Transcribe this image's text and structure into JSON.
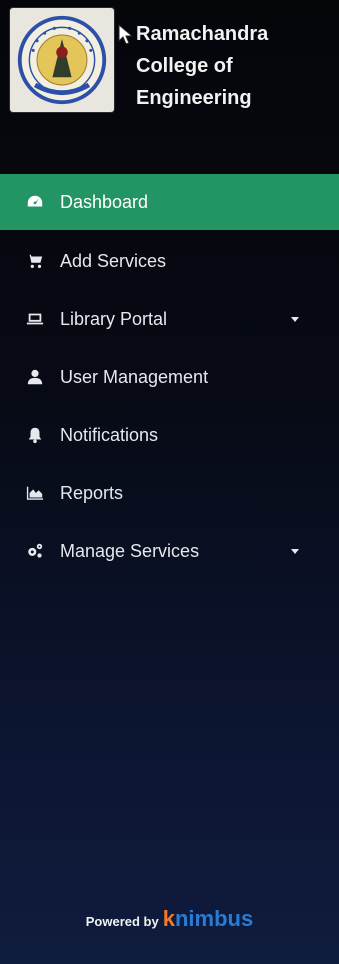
{
  "brand": {
    "name_line1": "Ramachandra",
    "name_line2": "College of",
    "name_line3": "Engineering"
  },
  "nav": {
    "items": [
      {
        "label": "Dashboard",
        "icon": "dashboard-icon",
        "active": true
      },
      {
        "label": "Add Services",
        "icon": "cart-icon"
      },
      {
        "label": "Library Portal",
        "icon": "laptop-icon",
        "has_dropdown": true
      },
      {
        "label": "User Management",
        "icon": "user-icon"
      },
      {
        "label": "Notifications",
        "icon": "bell-icon"
      },
      {
        "label": "Reports",
        "icon": "area-chart-icon"
      },
      {
        "label": "Manage Services",
        "icon": "cogs-icon",
        "has_dropdown": true
      }
    ]
  },
  "footer": {
    "powered_by": "Powered by",
    "brand_first": "k",
    "brand_rest": "nimbus"
  },
  "colors": {
    "active_bg": "#239564",
    "sidebar_bg_top": "#05060a",
    "sidebar_bg_bottom": "#101c3e",
    "knimbus_k": "#f07a2a",
    "knimbus_rest": "#2a7bd3"
  }
}
